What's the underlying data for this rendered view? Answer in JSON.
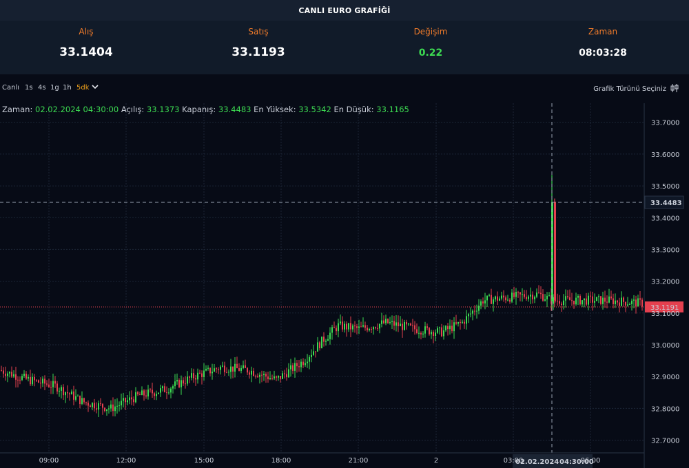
{
  "header": {
    "title": "CANLI EURO GRAFİĞİ"
  },
  "quotes": [
    {
      "label": "Alış",
      "value": "33.1404"
    },
    {
      "label": "Satış",
      "value": "33.1193"
    },
    {
      "label": "Değişim",
      "value": "0.22"
    },
    {
      "label": "Zaman",
      "value": "08:03:28"
    }
  ],
  "toolbar": {
    "timeframes": [
      "Canlı",
      "1s",
      "4s",
      "1g",
      "1h",
      "5dk"
    ],
    "active_timeframe": "5dk",
    "chart_type_label": "Grafik Türünü Seçiniz"
  },
  "ohlc": {
    "time_label": "Zaman:",
    "time_value": "02.02.2024 04:30:00",
    "open_label": "Açılış:",
    "open_value": "33.1373",
    "close_label": "Kapanış:",
    "close_value": "33.4483",
    "high_label": "En Yüksek:",
    "high_value": "33.5342",
    "low_label": "En Düşük:",
    "low_value": "33.1165"
  },
  "colors": {
    "up": "#3ddc52",
    "down": "#e5404f",
    "accent": "#f07b2a",
    "price_badge": "#e5404f"
  },
  "chart_data": {
    "type": "candlestick",
    "y_ticks": [
      "33.7000",
      "33.6000",
      "33.5000",
      "33.4000",
      "33.3000",
      "33.2000",
      "33.1000",
      "33.0000",
      "32.9000",
      "32.8000",
      "32.7000"
    ],
    "ylim": [
      32.66,
      33.76
    ],
    "x_ticks": [
      "09:00",
      "12:00",
      "15:00",
      "18:00",
      "21:00",
      "2",
      "03:00",
      "06:00"
    ],
    "crosshair": {
      "date": "02.02.2024",
      "time": "04:30:00",
      "price": "33.4483"
    },
    "last_price": "33.1191",
    "trend": [
      [
        0,
        32.92
      ],
      [
        40,
        32.89
      ],
      [
        80,
        32.87
      ],
      [
        120,
        32.82
      ],
      [
        160,
        32.8
      ],
      [
        200,
        32.84
      ],
      [
        240,
        32.86
      ],
      [
        280,
        32.9
      ],
      [
        320,
        32.93
      ],
      [
        360,
        32.92
      ],
      [
        400,
        32.89
      ],
      [
        440,
        32.95
      ],
      [
        470,
        33.02
      ],
      [
        490,
        33.06
      ],
      [
        520,
        33.05
      ],
      [
        560,
        33.07
      ],
      [
        600,
        33.05
      ],
      [
        640,
        33.04
      ],
      [
        670,
        33.07
      ],
      [
        700,
        33.14
      ],
      [
        740,
        33.15
      ],
      [
        780,
        33.16
      ],
      [
        800,
        33.14
      ],
      [
        840,
        33.14
      ],
      [
        880,
        33.14
      ],
      [
        935,
        33.13
      ]
    ],
    "spike": {
      "open": 33.1373,
      "close": 33.4483,
      "high": 33.5342,
      "low": 33.1165
    }
  }
}
